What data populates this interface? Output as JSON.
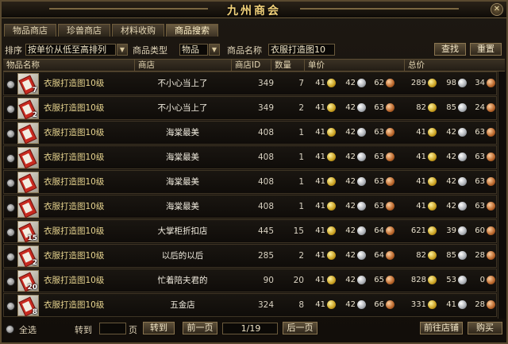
{
  "window": {
    "title": "九州商会",
    "close_icon": "close-icon"
  },
  "tabs": [
    {
      "label": "物品商店",
      "active": false
    },
    {
      "label": "珍兽商店",
      "active": false
    },
    {
      "label": "材料收购",
      "active": false
    },
    {
      "label": "商品搜索",
      "active": true
    }
  ],
  "filters": {
    "sort_label": "排序",
    "sort_value": "按单价从低至高排列",
    "type_label": "商品类型",
    "type_value": "物品",
    "name_label": "商品名称",
    "name_value": "衣服打造图10",
    "search_button": "查找",
    "reset_button": "重置"
  },
  "table": {
    "headers": [
      "物品名称",
      "商店",
      "商店ID",
      "数量",
      "单价",
      "总价"
    ],
    "rows": [
      {
        "qty_badge": "7",
        "name": "衣服打造图10级",
        "shop": "不小心当上了",
        "shop_id": "349",
        "count": "7",
        "unit": [
          "41",
          "42",
          "62"
        ],
        "total": [
          "289",
          "98",
          "34"
        ]
      },
      {
        "qty_badge": "2",
        "name": "衣服打造图10级",
        "shop": "不小心当上了",
        "shop_id": "349",
        "count": "2",
        "unit": [
          "41",
          "42",
          "63"
        ],
        "total": [
          "82",
          "85",
          "24"
        ]
      },
      {
        "qty_badge": "",
        "name": "衣服打造图10级",
        "shop": "海棠最美",
        "shop_id": "408",
        "count": "1",
        "unit": [
          "41",
          "42",
          "63"
        ],
        "total": [
          "41",
          "42",
          "63"
        ]
      },
      {
        "qty_badge": "",
        "name": "衣服打造图10级",
        "shop": "海棠最美",
        "shop_id": "408",
        "count": "1",
        "unit": [
          "41",
          "42",
          "63"
        ],
        "total": [
          "41",
          "42",
          "63"
        ]
      },
      {
        "qty_badge": "",
        "name": "衣服打造图10级",
        "shop": "海棠最美",
        "shop_id": "408",
        "count": "1",
        "unit": [
          "41",
          "42",
          "63"
        ],
        "total": [
          "41",
          "42",
          "63"
        ]
      },
      {
        "qty_badge": "",
        "name": "衣服打造图10级",
        "shop": "海棠最美",
        "shop_id": "408",
        "count": "1",
        "unit": [
          "41",
          "42",
          "63"
        ],
        "total": [
          "41",
          "42",
          "63"
        ]
      },
      {
        "qty_badge": "15",
        "name": "衣服打造图10级",
        "shop": "大掌柜折扣店",
        "shop_id": "445",
        "count": "15",
        "unit": [
          "41",
          "42",
          "64"
        ],
        "total": [
          "621",
          "39",
          "60"
        ]
      },
      {
        "qty_badge": "2",
        "name": "衣服打造图10级",
        "shop": "以后的以后",
        "shop_id": "285",
        "count": "2",
        "unit": [
          "41",
          "42",
          "64"
        ],
        "total": [
          "82",
          "85",
          "28"
        ]
      },
      {
        "qty_badge": "20",
        "name": "衣服打造图10级",
        "shop": "忙着陪夫君的",
        "shop_id": "90",
        "count": "20",
        "unit": [
          "41",
          "42",
          "65"
        ],
        "total": [
          "828",
          "53",
          "0"
        ]
      },
      {
        "qty_badge": "8",
        "name": "衣服打造图10级",
        "shop": "五金店",
        "shop_id": "324",
        "count": "8",
        "unit": [
          "41",
          "42",
          "66"
        ],
        "total": [
          "331",
          "41",
          "28"
        ]
      }
    ]
  },
  "footer": {
    "select_all": "全选",
    "goto_label": "转到",
    "page_input": "",
    "page_unit": "页",
    "goto_button": "转到",
    "prev_button": "前一页",
    "page_indicator": "1/19",
    "next_button": "后一页",
    "go_shop_button": "前往店铺",
    "buy_button": "购买"
  },
  "colors": {
    "gold_coin": "#c9a020",
    "silver_coin": "#a9adb3",
    "copper_coin": "#b8652a",
    "item_name": "#e7d48f"
  }
}
